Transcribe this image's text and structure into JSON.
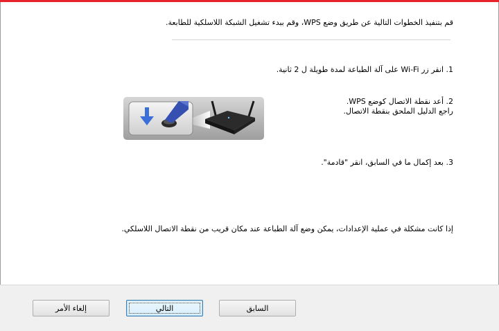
{
  "content": {
    "intro": "قم بتنفيذ الخطوات التالية عن طريق وضع WPS، وقم ببدء تشغيل الشبكة اللاسلكية للطابعة.",
    "step1": "1. انقر زر Wi-Fi على آلة الطباعة لمدة طويلة ل 2 ثانية.",
    "step2_line1": "2. أعد نقطة الاتصال كوضع WPS.",
    "step2_line2": "راجع الدليل الملحق بنقطة الاتصال.",
    "step3": "3. بعد إكمال ما في السابق، انقر \"قادمة\".",
    "hint": "إذا كانت مشكلة في عملية الإعدادات، يمكن وضع آلة الطباعة عند مكان قريب من نقطة الاتصال اللاسلكي."
  },
  "illustration": {
    "icons": [
      "down-arrow-icon",
      "finger-icon",
      "wps-button-icon",
      "router-icon"
    ]
  },
  "buttons": {
    "back": "السابق",
    "next": "التالي",
    "cancel": "إلغاء الأمر"
  },
  "colors": {
    "accent_bar": "#e8212b",
    "arrow_blue": "#3a6fd8",
    "default_button_border": "#3c7fb1"
  }
}
